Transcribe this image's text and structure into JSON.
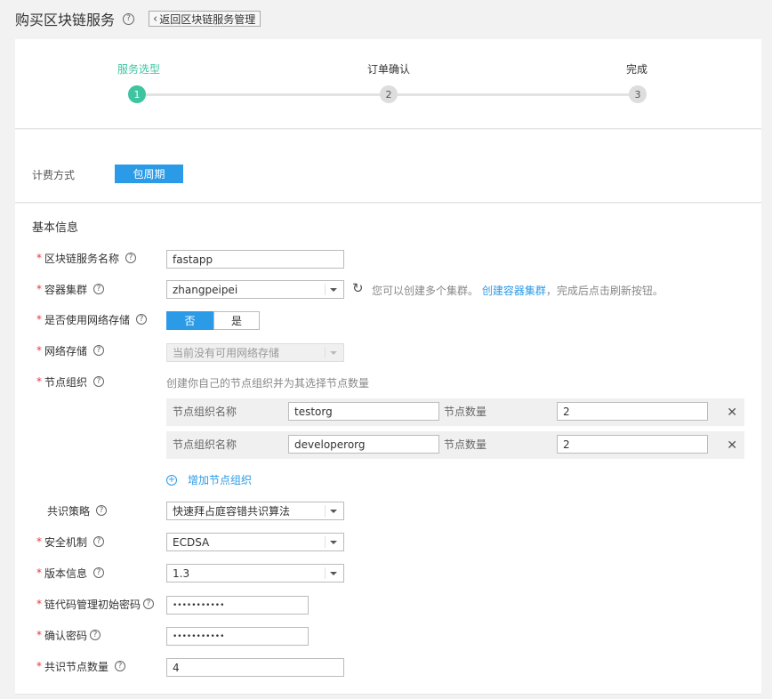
{
  "header": {
    "title": "购买区块链服务",
    "back_label": "返回区块链服务管理"
  },
  "steps": [
    {
      "label": "服务选型",
      "num": "1",
      "active": true
    },
    {
      "label": "订单确认",
      "num": "2",
      "active": false
    },
    {
      "label": "完成",
      "num": "3",
      "active": false
    }
  ],
  "billing": {
    "label": "计费方式",
    "option": "包周期"
  },
  "basic": {
    "title": "基本信息",
    "service_name": {
      "label": "区块链服务名称",
      "value": "fastapp"
    },
    "cluster": {
      "label": "容器集群",
      "value": "zhangpeipei",
      "hint_pre": "您可以创建多个集群。",
      "hint_link": "创建容器集群",
      "hint_post": "，完成后点击刷新按钮。"
    },
    "use_storage": {
      "label": "是否使用网络存储",
      "no": "否",
      "yes": "是"
    },
    "storage": {
      "label": "网络存储",
      "value": "当前没有可用网络存储"
    },
    "node_org": {
      "label": "节点组织",
      "hint": "创建你自己的节点组织并为其选择节点数量",
      "name_label": "节点组织名称",
      "count_label": "节点数量",
      "rows": [
        {
          "name": "testorg",
          "count": "2"
        },
        {
          "name": "developerorg",
          "count": "2"
        }
      ],
      "add_label": "增加节点组织"
    },
    "consensus": {
      "label": "共识策略",
      "value": "快速拜占庭容错共识算法"
    },
    "security": {
      "label": "安全机制",
      "value": "ECDSA"
    },
    "version": {
      "label": "版本信息",
      "value": "1.3"
    },
    "chaincode_pwd": {
      "label": "链代码管理初始密码",
      "value": "•••••••••••"
    },
    "confirm_pwd": {
      "label": "确认密码",
      "value": "•••••••••••"
    },
    "consensus_nodes": {
      "label": "共识节点数量",
      "value": "4"
    }
  },
  "colors": {
    "accent": "#2b9be8",
    "step_active": "#3ec4a0",
    "required": "#e4393c"
  },
  "icons": [
    "help-icon",
    "chevron-left-icon",
    "refresh-icon",
    "close-icon",
    "plus-circle-icon",
    "caret-down-icon"
  ]
}
